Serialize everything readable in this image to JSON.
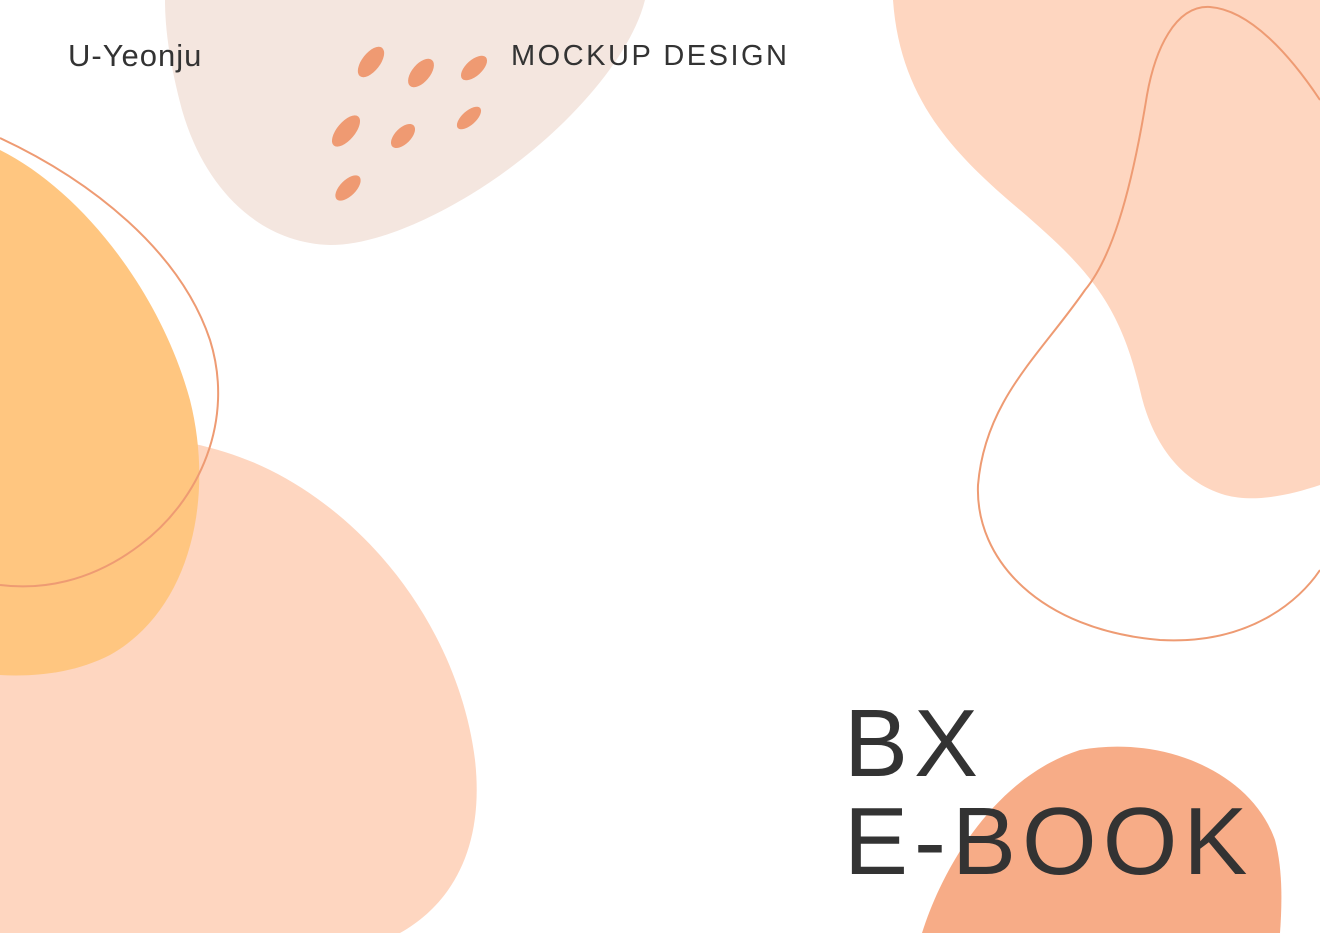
{
  "cover": {
    "author": "U-Yeonju",
    "subtitle": "MOCKUP DESIGN",
    "title_line1": "BX",
    "title_line2": "E-BOOK"
  },
  "colors": {
    "background": "#ffffff",
    "text": "#333333",
    "blush_blob": "#f4e6df",
    "peach_blob": "#fed6c0",
    "yellow_blob": "#ffc680",
    "coral_blob": "#f7ac87",
    "coral_accent": "#ef9a72"
  }
}
